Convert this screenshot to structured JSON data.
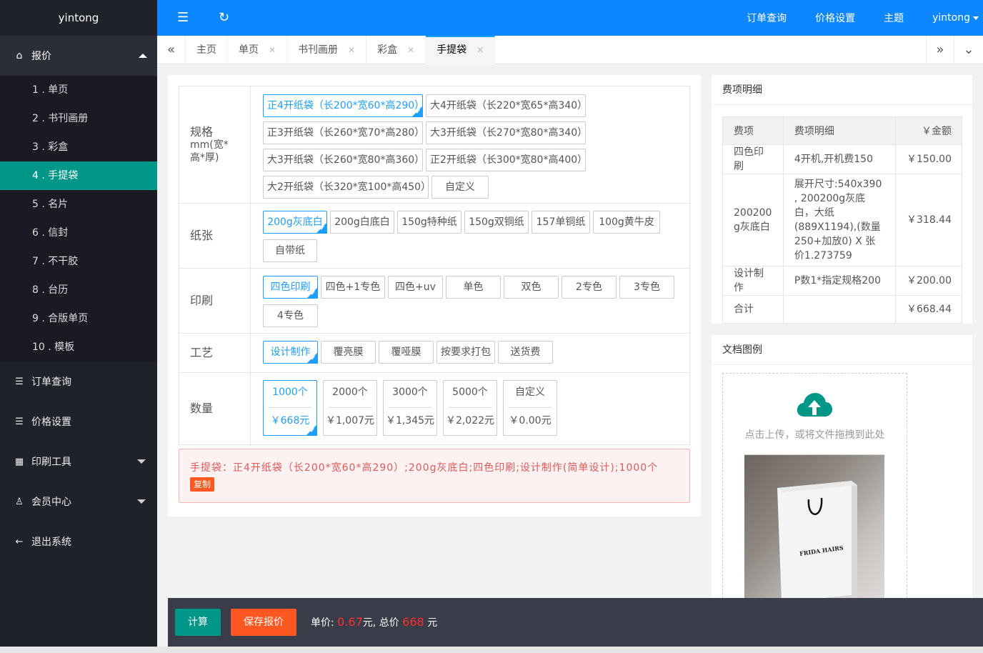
{
  "app": {
    "brand": "yintong"
  },
  "sidebar": {
    "quote": {
      "label": "报价"
    },
    "sub_items": [
      {
        "label": "1 . 单页"
      },
      {
        "label": "2 . 书刊画册"
      },
      {
        "label": "3 . 彩盒"
      },
      {
        "label": "4 . 手提袋",
        "active": true
      },
      {
        "label": "5 . 名片"
      },
      {
        "label": "6 . 信封"
      },
      {
        "label": "7 . 不干胶"
      },
      {
        "label": "8 . 台历"
      },
      {
        "label": "9 . 合版单页"
      },
      {
        "label": "10 . 模板"
      }
    ],
    "items": [
      {
        "label": "订单查询",
        "icon": "list-icon"
      },
      {
        "label": "价格设置",
        "icon": "list-icon"
      },
      {
        "label": "印刷工具",
        "icon": "app-icon"
      },
      {
        "label": "会员中心",
        "icon": "user-icon"
      },
      {
        "label": "退出系统",
        "icon": "arrow-left-icon"
      }
    ]
  },
  "header": {
    "links": [
      "订单查询",
      "价格设置",
      "主题"
    ],
    "user": "yintong"
  },
  "tabs": {
    "items": [
      {
        "label": "主页"
      },
      {
        "label": "单页"
      },
      {
        "label": "书刊画册"
      },
      {
        "label": "彩盒"
      },
      {
        "label": "手提袋",
        "active": true
      }
    ]
  },
  "options": {
    "spec": {
      "label_line1": "规格",
      "label_line2": "mm(宽*",
      "label_line3": "高*厚)",
      "values": [
        "正4开纸袋（长200*宽60*高290）",
        "大4开纸袋（长220*宽65*高340）",
        "正3开纸袋（长260*宽70*高280）",
        "大3开纸袋（长270*宽80*高340）",
        "大3开纸袋（长260*宽80*高360）",
        "正2开纸袋（长300*宽80*高400）",
        "大2开纸袋（长320*宽100*高450）",
        "自定义"
      ]
    },
    "paper": {
      "label": "纸张",
      "values": [
        "200g灰底白",
        "200g白底白",
        "150g特种纸",
        "150g双铜纸",
        "157单铜纸",
        "100g黄牛皮",
        "自带纸"
      ]
    },
    "print": {
      "label": "印刷",
      "values": [
        "四色印刷",
        "四色+1专色",
        "四色+uv",
        "单色",
        "双色",
        "2专色",
        "3专色",
        "4专色"
      ]
    },
    "craft": {
      "label": "工艺",
      "values": [
        "设计制作",
        "覆亮膜",
        "覆哑膜",
        "按要求打包",
        "送货费"
      ]
    },
    "quantity": {
      "label": "数量",
      "values": [
        {
          "qty": "1000个",
          "price": "￥668元"
        },
        {
          "qty": "2000个",
          "price": "￥1,007元"
        },
        {
          "qty": "3000个",
          "price": "￥1,345元"
        },
        {
          "qty": "5000个",
          "price": "￥2,022元"
        },
        {
          "qty": "自定义",
          "price": "￥0.00元"
        }
      ]
    }
  },
  "summary": {
    "text": "手提袋：正4开纸袋（长200*宽60*高290）;200g灰底白;四色印刷;设计制作(简单设计);1000个",
    "copy_label": "复制"
  },
  "fee": {
    "title": "费项明细",
    "headers": [
      "费项",
      "费项明细",
      "￥金额"
    ],
    "rows": [
      {
        "item": "四色印刷",
        "detail": "4开机,开机费150",
        "amount": "￥150.00"
      },
      {
        "item": "200200g灰底白",
        "detail": "展开尺寸:540x390 , 200200g灰底白，大纸(889X1194),(数量250+加放0) X 张价1.273759",
        "amount": "￥318.44"
      },
      {
        "item": "设计制作",
        "detail": "P数1*指定规格200",
        "amount": "￥200.00"
      },
      {
        "item": "合计",
        "detail": "",
        "amount": "￥668.44"
      }
    ]
  },
  "docs": {
    "title": "文档图例",
    "upload_hint": "点击上传，或将文件拖拽到此处",
    "bag_text": "FRIDA HAIRS"
  },
  "bottom": {
    "calc_label": "计算",
    "save_label": "保存报价",
    "unit_label": "单价:",
    "unit_value": "0.67",
    "unit_suffix": "元, 总价",
    "total_value": "668",
    "total_suffix": "元"
  },
  "colors": {
    "accent": "#1e9fff",
    "teal": "#009688",
    "orange": "#ff5722",
    "header": "#0d87ff"
  }
}
